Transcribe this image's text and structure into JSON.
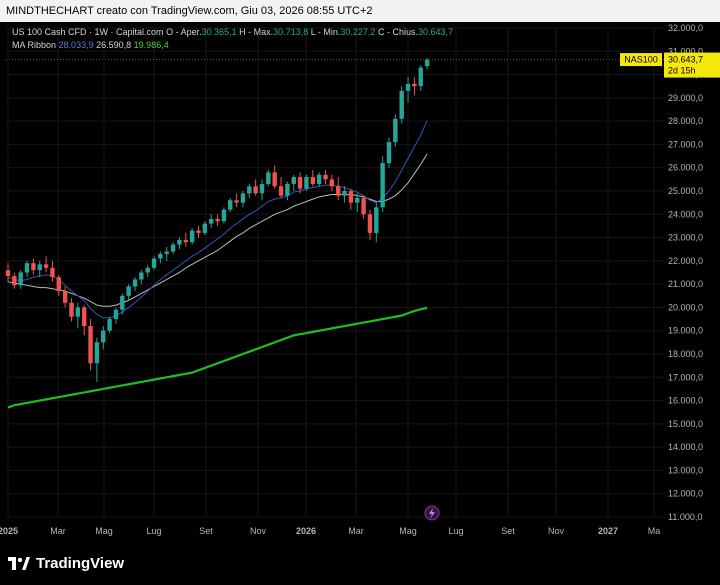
{
  "header": {
    "attribution": "MINDTHECHART creato con TradingView.com, Giu 03, 2026 08:55 UTC+2"
  },
  "legend": {
    "instrument": "US 100 Cash CFD · 1W · Capital.com",
    "open_label": "O - Aper.",
    "open": "30.365,1",
    "high_label": "H - Max.",
    "high": "30.713,8",
    "low_label": "L - Min.",
    "low": "30.227,2",
    "close_label": "C - Chius.",
    "close": "30.643,7",
    "ma_label": "MA Ribbon",
    "ma1": "28.033,9",
    "ma2": "26.590,8",
    "ma3": "19.986,4"
  },
  "price_tag": {
    "symbol": "NAS100",
    "price": "30.643,7",
    "countdown": "2d 15h"
  },
  "footer": {
    "brand": "TradingView"
  },
  "colors": {
    "up": "#26a69a",
    "down": "#ef5350",
    "ma1": "#3355bb",
    "ma2": "#bbbbbb",
    "ma3": "#1fbf1f",
    "tag": "#f5e80b"
  },
  "chart_data": {
    "type": "candlestick",
    "ylim": [
      11000,
      32000
    ],
    "y_ticks": [
      11000,
      12000,
      13000,
      14000,
      15000,
      16000,
      17000,
      18000,
      19000,
      20000,
      21000,
      22000,
      23000,
      24000,
      25000,
      26000,
      27000,
      28000,
      29000,
      30000,
      31000,
      32000
    ],
    "y_tick_labels": [
      "11.000,0",
      "12.000,0",
      "13.000,0",
      "14.000,0",
      "15.000,0",
      "16.000,0",
      "17.000,0",
      "18.000,0",
      "19.000,0",
      "20.000,0",
      "21.000,0",
      "22.000,0",
      "23.000,0",
      "24.000,0",
      "25.000,0",
      "26.000,0",
      "27.000,0",
      "28.000,0",
      "29.000,0",
      "30.000,0",
      "31.000,0",
      "32.000,0"
    ],
    "x_labels": [
      "2025",
      "Mar",
      "Mag",
      "Lug",
      "Set",
      "Nov",
      "2026",
      "Mar",
      "Mag",
      "Lug",
      "Set",
      "Nov",
      "2027",
      "Ma"
    ],
    "bold_x_labels": [
      "2025",
      "2026",
      "2027"
    ],
    "candles": [
      [
        21600,
        21900,
        21100,
        21350
      ],
      [
        21350,
        21500,
        20800,
        20950
      ],
      [
        20950,
        21600,
        20800,
        21500
      ],
      [
        21500,
        22000,
        21300,
        21900
      ],
      [
        21900,
        22100,
        21400,
        21600
      ],
      [
        21600,
        22000,
        21300,
        21850
      ],
      [
        21850,
        22200,
        21500,
        21700
      ],
      [
        21700,
        22000,
        21100,
        21300
      ],
      [
        21300,
        21400,
        20500,
        20700
      ],
      [
        20700,
        20900,
        20000,
        20200
      ],
      [
        20200,
        20400,
        19400,
        19600
      ],
      [
        19600,
        20200,
        19100,
        20000
      ],
      [
        20000,
        20100,
        18800,
        19200
      ],
      [
        19200,
        19500,
        17300,
        17600
      ],
      [
        17600,
        18700,
        16800,
        18500
      ],
      [
        18500,
        19200,
        18200,
        19000
      ],
      [
        19000,
        19600,
        18900,
        19500
      ],
      [
        19500,
        20000,
        19300,
        19900
      ],
      [
        19900,
        20600,
        19700,
        20500
      ],
      [
        20500,
        21000,
        20300,
        20900
      ],
      [
        20900,
        21300,
        20700,
        21200
      ],
      [
        21200,
        21600,
        21000,
        21500
      ],
      [
        21500,
        21800,
        21300,
        21700
      ],
      [
        21700,
        22200,
        21600,
        22100
      ],
      [
        22100,
        22400,
        21900,
        22300
      ],
      [
        22300,
        22600,
        22000,
        22400
      ],
      [
        22400,
        22800,
        22300,
        22700
      ],
      [
        22700,
        23000,
        22500,
        22900
      ],
      [
        22900,
        23200,
        22600,
        22800
      ],
      [
        22800,
        23400,
        22700,
        23300
      ],
      [
        23300,
        23500,
        23000,
        23200
      ],
      [
        23200,
        23700,
        23100,
        23600
      ],
      [
        23600,
        24000,
        23400,
        23800
      ],
      [
        23800,
        24000,
        23500,
        23700
      ],
      [
        23700,
        24300,
        23600,
        24200
      ],
      [
        24200,
        24700,
        24100,
        24600
      ],
      [
        24600,
        24900,
        24300,
        24500
      ],
      [
        24500,
        25000,
        24300,
        24900
      ],
      [
        24900,
        25300,
        24700,
        25200
      ],
      [
        25200,
        25500,
        24800,
        24900
      ],
      [
        24900,
        25500,
        24600,
        25300
      ],
      [
        25300,
        25900,
        25200,
        25800
      ],
      [
        25800,
        26100,
        25100,
        25200
      ],
      [
        25200,
        25600,
        24700,
        24800
      ],
      [
        24800,
        25400,
        24600,
        25300
      ],
      [
        25300,
        25700,
        25000,
        25600
      ],
      [
        25600,
        25800,
        24900,
        25100
      ],
      [
        25100,
        25700,
        25000,
        25600
      ],
      [
        25600,
        25900,
        25200,
        25300
      ],
      [
        25300,
        25800,
        25200,
        25700
      ],
      [
        25700,
        25900,
        25300,
        25500
      ],
      [
        25500,
        25700,
        25000,
        25200
      ],
      [
        25200,
        25600,
        24600,
        24800
      ],
      [
        24800,
        25200,
        24500,
        25000
      ],
      [
        25000,
        25100,
        24200,
        24500
      ],
      [
        24500,
        24900,
        24100,
        24700
      ],
      [
        24700,
        24800,
        23800,
        24000
      ],
      [
        24000,
        24200,
        22900,
        23200
      ],
      [
        23200,
        24500,
        22800,
        24300
      ],
      [
        24300,
        26500,
        24100,
        26200
      ],
      [
        26200,
        27300,
        26000,
        27100
      ],
      [
        27100,
        28300,
        26900,
        28100
      ],
      [
        28100,
        29500,
        27900,
        29300
      ],
      [
        29300,
        29900,
        28800,
        29600
      ],
      [
        29600,
        29900,
        29100,
        29500
      ],
      [
        29500,
        30400,
        29300,
        30300
      ],
      [
        30365,
        30714,
        30227,
        30644
      ]
    ],
    "ma1": [
      21300,
      21200,
      21150,
      21200,
      21300,
      21350,
      21400,
      21350,
      21200,
      20950,
      20700,
      20500,
      20300,
      19950,
      19700,
      19550,
      19550,
      19650,
      19800,
      20000,
      20200,
      20450,
      20700,
      20950,
      21200,
      21400,
      21600,
      21800,
      22000,
      22200,
      22350,
      22550,
      22750,
      22950,
      23150,
      23400,
      23600,
      23800,
      24000,
      24150,
      24350,
      24550,
      24650,
      24700,
      24800,
      24950,
      25000,
      25100,
      25150,
      25200,
      25250,
      25250,
      25200,
      25150,
      25050,
      24950,
      24800,
      24600,
      24500,
      24700,
      25000,
      25400,
      25900,
      26400,
      26900,
      27400,
      28030
    ],
    "ma2": [
      21100,
      21050,
      21000,
      20950,
      20900,
      20850,
      20850,
      20800,
      20750,
      20700,
      20600,
      20500,
      20400,
      20250,
      20100,
      20050,
      20050,
      20100,
      20200,
      20300,
      20450,
      20600,
      20750,
      20900,
      21050,
      21200,
      21350,
      21500,
      21700,
      21850,
      22000,
      22150,
      22300,
      22450,
      22650,
      22850,
      23050,
      23200,
      23400,
      23550,
      23700,
      23850,
      24000,
      24100,
      24200,
      24350,
      24450,
      24550,
      24650,
      24750,
      24800,
      24850,
      24850,
      24850,
      24850,
      24800,
      24750,
      24650,
      24550,
      24550,
      24650,
      24800,
      25050,
      25350,
      25750,
      26150,
      26590
    ],
    "ma3": [
      15700,
      15800,
      15850,
      15900,
      15950,
      16000,
      16050,
      16100,
      16150,
      16200,
      16250,
      16300,
      16350,
      16400,
      16450,
      16500,
      16550,
      16600,
      16650,
      16700,
      16750,
      16800,
      16850,
      16900,
      16950,
      17000,
      17050,
      17100,
      17150,
      17200,
      17300,
      17400,
      17500,
      17600,
      17700,
      17800,
      17900,
      18000,
      18100,
      18200,
      18300,
      18400,
      18500,
      18600,
      18700,
      18800,
      18850,
      18900,
      18950,
      19000,
      19050,
      19100,
      19150,
      19200,
      19250,
      19300,
      19350,
      19400,
      19450,
      19500,
      19550,
      19600,
      19650,
      19750,
      19850,
      19920,
      19986
    ]
  }
}
